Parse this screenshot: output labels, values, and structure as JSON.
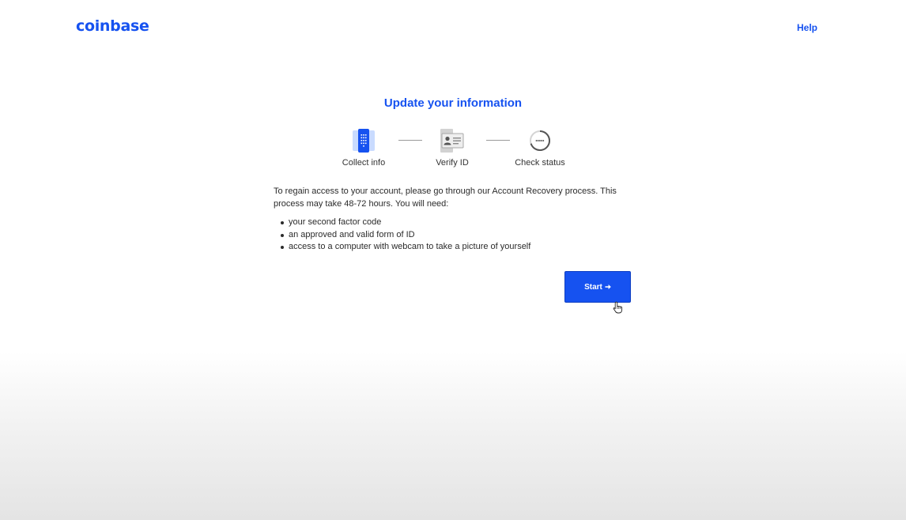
{
  "header": {
    "logo_text": "coinbase",
    "help_label": "Help"
  },
  "main": {
    "title": "Update your information",
    "steps": [
      {
        "label": "Collect info",
        "icon": "phone-keypad-icon"
      },
      {
        "label": "Verify ID",
        "icon": "id-card-icon"
      },
      {
        "label": "Check status",
        "icon": "status-spinner-icon"
      }
    ],
    "intro_text": "To regain access to your account, please go through our Account Recovery process. This process may take 48-72 hours. You will need:",
    "requirements": [
      "your second factor code",
      "an approved and valid form of ID",
      "access to a computer with webcam to take a picture of yourself"
    ],
    "start_label": "Start",
    "start_icon": "arrow-right-icon"
  },
  "colors": {
    "brand": "#1652f0",
    "text": "#2b2b2b"
  }
}
